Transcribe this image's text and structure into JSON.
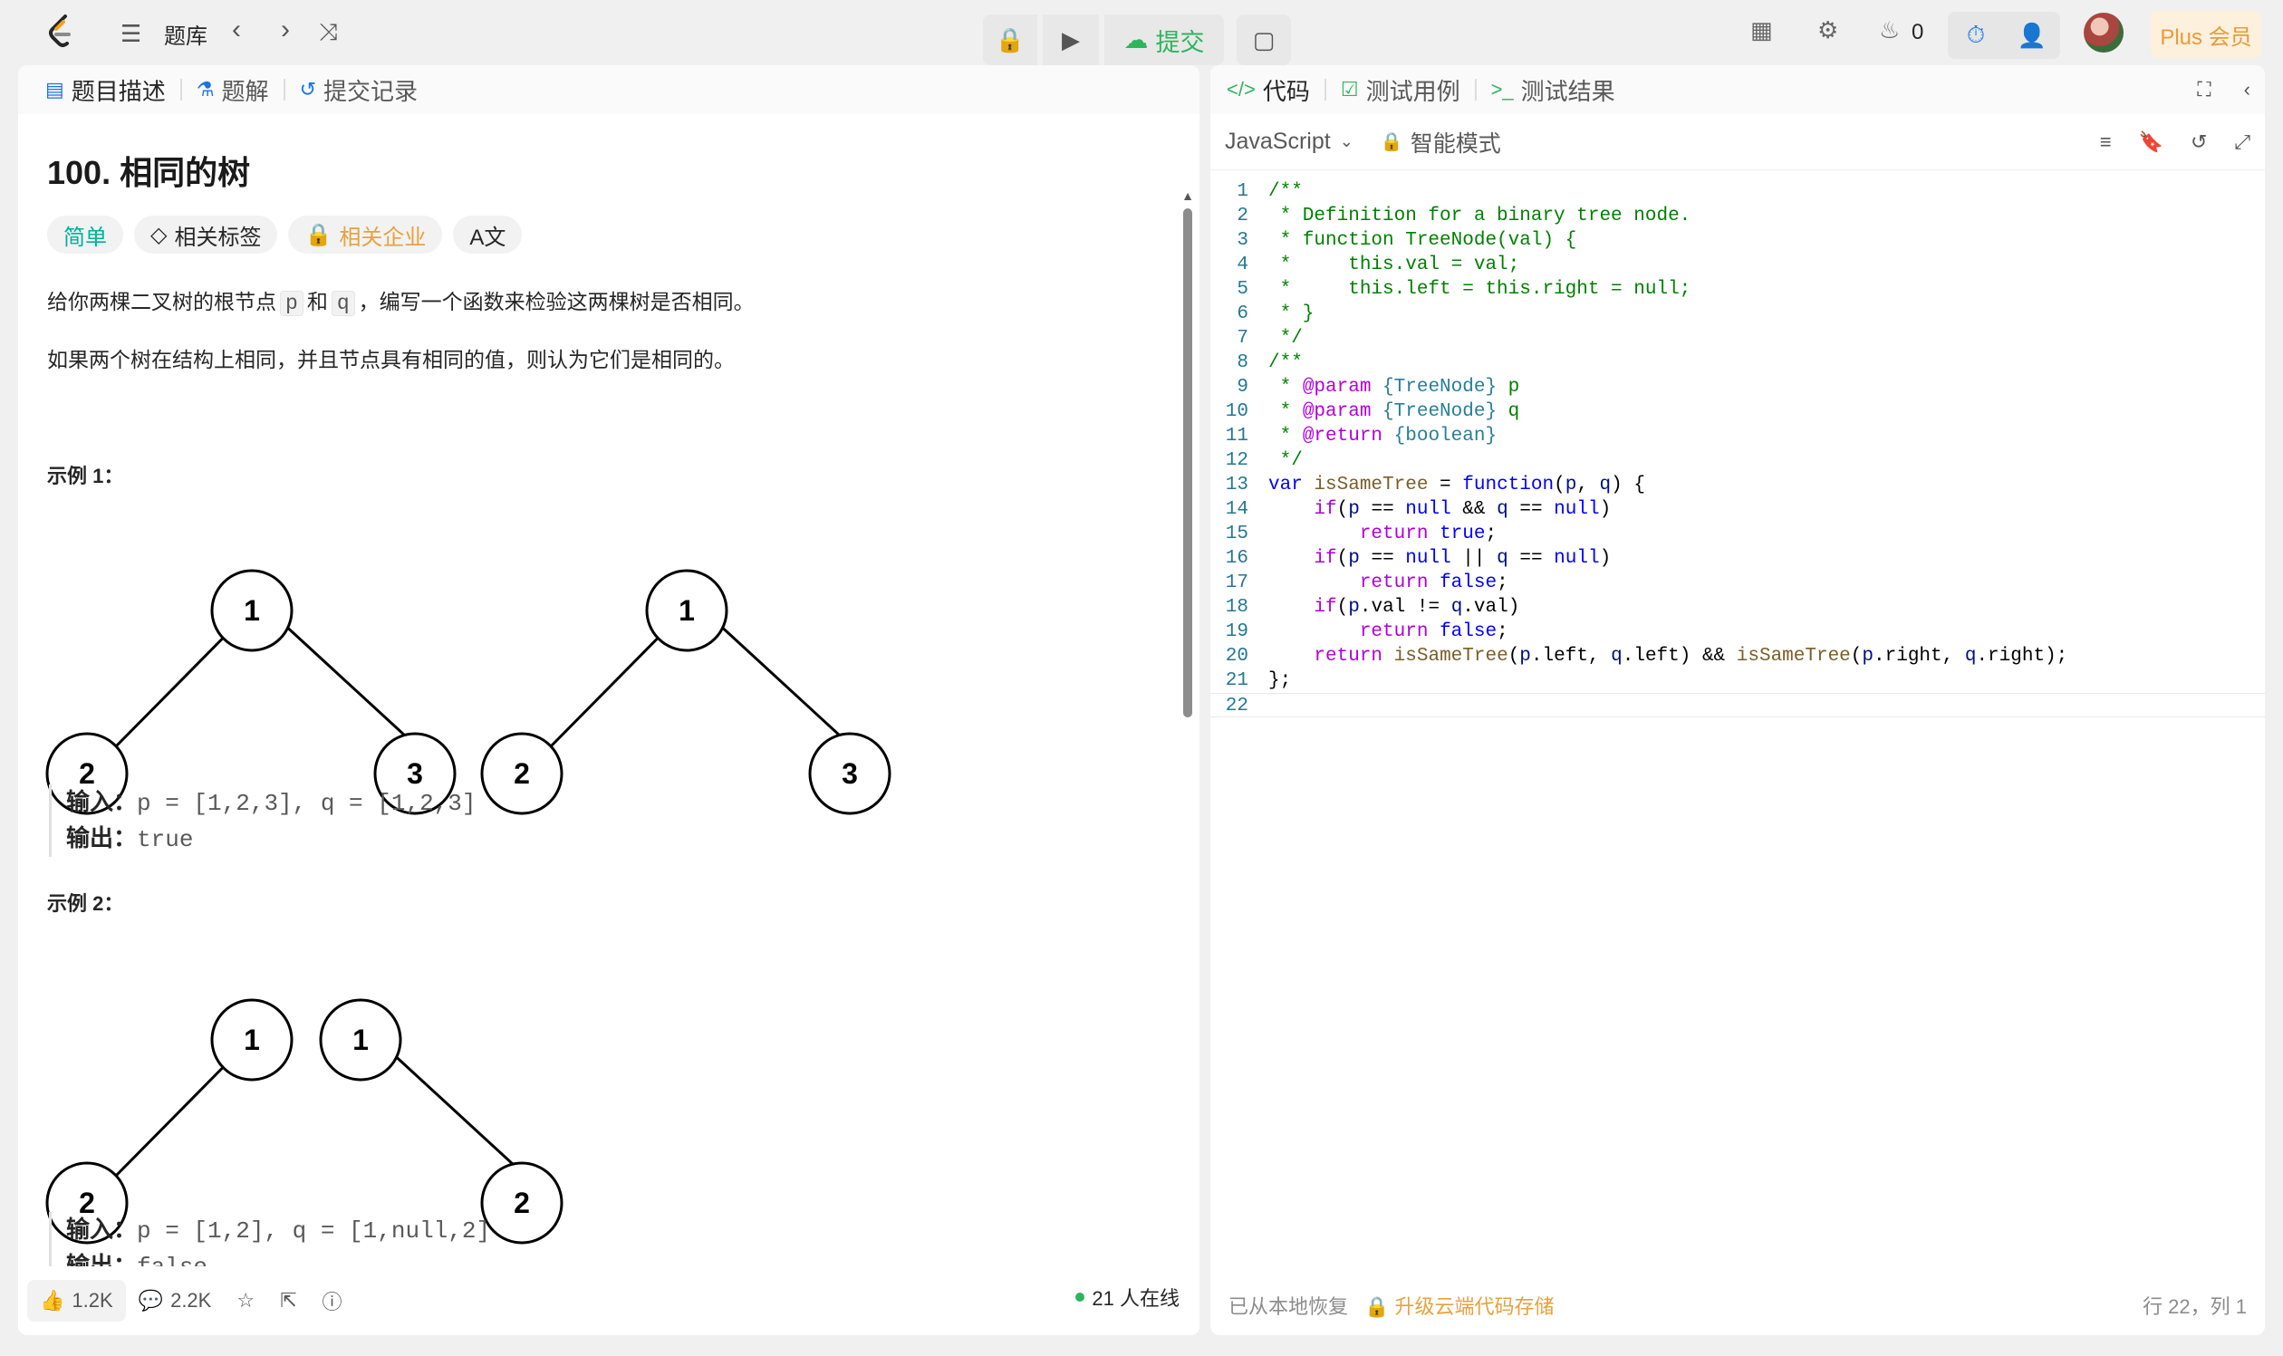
{
  "topbar": {
    "nav_title": "题库",
    "submit_label": "提交",
    "streak_count": "0",
    "plus_label": "Plus 会员"
  },
  "left_tabs": {
    "description": "题目描述",
    "solutions": "题解",
    "submissions": "提交记录"
  },
  "problem": {
    "title": "100. 相同的树",
    "tags": {
      "difficulty": "简单",
      "related_tags": "相关标签",
      "related_companies": "相关企业"
    },
    "desc_part1": "给你两棵二叉树的根节点",
    "p": "p",
    "and": "和",
    "q": "q",
    "desc_part2": "，编写一个函数来检验这两棵树是否相同。",
    "desc_line2": "如果两个树在结构上相同，并且节点具有相同的值，则认为它们是相同的。",
    "example1": {
      "title": "示例 1：",
      "input_label": "输入：",
      "input": "p = [1,2,3], q = [1,2,3]",
      "output_label": "输出：",
      "output": "true",
      "nodes": [
        "1",
        "2",
        "3",
        "1",
        "2",
        "3"
      ]
    },
    "example2": {
      "title": "示例 2：",
      "input_label": "输入：",
      "input": "p = [1,2], q = [1,null,2]",
      "output_label": "输出：",
      "output": "false",
      "nodes": [
        "1",
        "2",
        "1",
        "2"
      ]
    }
  },
  "left_bottom": {
    "likes": "1.2K",
    "comments": "2.2K",
    "online": "21 人在线"
  },
  "right_tabs": {
    "code": "代码",
    "testcases": "测试用例",
    "result": "测试结果"
  },
  "editor_toolbar": {
    "language": "JavaScript",
    "mode": "智能模式"
  },
  "code_lines": [
    "/**",
    " * Definition for a binary tree node.",
    " * function TreeNode(val) {",
    " *     this.val = val;",
    " *     this.left = this.right = null;",
    " * }",
    " */",
    "/**",
    " * @param {TreeNode} p",
    " * @param {TreeNode} q",
    " * @return {boolean}",
    " */",
    "var isSameTree = function(p, q) {",
    "    if(p == null && q == null)",
    "        return true;",
    "    if(p == null || q == null)",
    "        return false;",
    "    if(p.val != q.val)",
    "        return false;",
    "    return isSameTree(p.left, q.left) && isSameTree(p.right, q.right);",
    "};",
    ""
  ],
  "right_status": {
    "restored": "已从本地恢复",
    "upgrade": "升级云端代码存储",
    "position": "行 22，列 1"
  },
  "colors": {
    "easy": "#00af9b",
    "submit": "#2db55d",
    "plus": "#e89b3c",
    "company_locked": "#e6a23c"
  }
}
